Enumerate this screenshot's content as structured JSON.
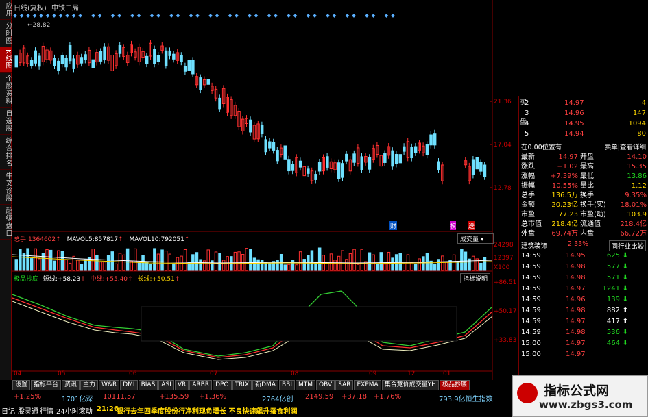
{
  "header": {
    "title": "日线(复权)",
    "stock_name": "中铁二局",
    "high_label": "28.82"
  },
  "sidebar": {
    "tabs": [
      {
        "label": "应用"
      },
      {
        "label": "分时图"
      },
      {
        "label": "K线图",
        "active": true
      },
      {
        "label": "个股资料"
      },
      {
        "label": "自选股"
      },
      {
        "label": "综合排名"
      },
      {
        "label": "牛叉诊股"
      },
      {
        "label": "超级盘口"
      }
    ]
  },
  "price_axis": {
    "labels": [
      "21.36",
      "17.04",
      "12.78"
    ]
  },
  "volume_panel": {
    "vol_label": "总手:",
    "vol_value": "1364602",
    "mavol5_label": "MAVOL5:",
    "mavol5_value": "857817",
    "mavol10_label": "MAVOL10:",
    "mavol10_value": "792051",
    "axis": [
      "24298",
      "12397",
      "X100"
    ],
    "dropdown": "成交量"
  },
  "indicator_panel": {
    "name": "极品抄底",
    "short_label": "短线:",
    "short_value": "+58.23",
    "mid_label": "中线:",
    "mid_value": "+55.40",
    "long_label": "长线:",
    "long_value": "+50.51",
    "axis": [
      "+86.51",
      "+50.17",
      "+33.83"
    ],
    "help": "指标说明"
  },
  "event_marks": {
    "cai1": "财",
    "cai2": "财",
    "quan": "权",
    "zeng": "送"
  },
  "date_axis": [
    "04",
    "05",
    "06",
    "07",
    "08",
    "09",
    "12",
    "01"
  ],
  "quote": {
    "asks": [
      {
        "level": "2",
        "price": "14.97",
        "vol": "4"
      },
      {
        "level": "3",
        "price": "14.96",
        "vol": "147"
      },
      {
        "level": "4",
        "price": "14.95",
        "vol": "1094"
      },
      {
        "level": "5",
        "price": "14.94",
        "vol": "80"
      }
    ],
    "ask_label": "买",
    "ask_label2": "盘",
    "position_text": "在0.00位置有",
    "link1": "卖单",
    "link2": "查看详细",
    "fields": [
      {
        "l1": "最新",
        "v1": "14.97",
        "l2": "开盘",
        "v2": "14.10"
      },
      {
        "l1": "涨跌",
        "v1": "+1.02",
        "l2": "最高",
        "v2": "15.35"
      },
      {
        "l1": "涨幅",
        "v1": "+7.39%",
        "l2": "最低",
        "v2": "13.86"
      },
      {
        "l1": "振幅",
        "v1": "10.55%",
        "l2": "量比",
        "v2": "1.12"
      },
      {
        "l1": "总手",
        "v1": "136.5万",
        "l2": "换手",
        "v2": "9.35%"
      },
      {
        "l1": "金额",
        "v1": "20.23亿",
        "l2": "换手(实)",
        "v2": "18.01%"
      },
      {
        "l1": "市盈",
        "v1": "77.23",
        "l2": "市盈(动)",
        "v2": "103.9"
      },
      {
        "l1": "总市值",
        "v1": "218.4亿",
        "l2": "流通值",
        "v2": "218.4亿"
      },
      {
        "l1": "外盘",
        "v1": "69.74万",
        "l2": "内盘",
        "v2": "66.72万"
      }
    ],
    "sector": "建筑装饰",
    "sector_pct": "2.33%",
    "sector_link": "同行业比较",
    "ticks": [
      {
        "t": "14:59",
        "p": "14.95",
        "v": "625",
        "d": "down"
      },
      {
        "t": "14:59",
        "p": "14.98",
        "v": "577",
        "d": "down"
      },
      {
        "t": "14:59",
        "p": "14.98",
        "v": "571",
        "d": "down"
      },
      {
        "t": "14:59",
        "p": "14.97",
        "v": "1241",
        "d": "down"
      },
      {
        "t": "14:59",
        "p": "14.96",
        "v": "139",
        "d": "down"
      },
      {
        "t": "14:59",
        "p": "14.98",
        "v": "882",
        "d": "up"
      },
      {
        "t": "14:59",
        "p": "14.97",
        "v": "417",
        "d": "up"
      },
      {
        "t": "14:59",
        "p": "14.98",
        "v": "536",
        "d": "down"
      },
      {
        "t": "15:00",
        "p": "14.97",
        "v": "464",
        "d": "down"
      },
      {
        "t": "15:00",
        "p": "14.97",
        "v": "",
        "d": ""
      }
    ]
  },
  "bottom_tabs": [
    "设置",
    "指标平台",
    "资讯",
    "主力",
    "W&R",
    "DMI",
    "BIAS",
    "ASI",
    "VR",
    "ARBR",
    "DPO",
    "TRIX",
    "新DMA",
    "BBI",
    "MTM",
    "OBV",
    "SAR",
    "EXPMA",
    "集合竞价成交量YH",
    "极品抄底"
  ],
  "tickers": {
    "r1": [
      {
        "t": "+1.25%",
        "c": "red"
      },
      {
        "t": "1701亿深",
        "c": "cyan"
      },
      {
        "t": "10111.57",
        "c": "red"
      },
      {
        "t": "+135.59",
        "c": "red"
      },
      {
        "t": "+1.36%",
        "c": "red"
      },
      {
        "t": "2764亿创",
        "c": "cyan"
      },
      {
        "t": "2149.59",
        "c": "red"
      },
      {
        "t": "+37.18",
        "c": "red"
      },
      {
        "t": "+1.76%",
        "c": "red"
      },
      {
        "t": "793.9亿恒生指数",
        "c": "cyan"
      }
    ],
    "r2": [
      {
        "t": "日记",
        "c": "white"
      },
      {
        "t": "股灵通",
        "c": "white"
      },
      {
        "t": "行情",
        "c": "white"
      },
      {
        "t": "24小时滚动",
        "c": "white"
      },
      {
        "t": "21:26",
        "c": "yellow"
      },
      {
        "t": "银行去年四季度股份行净利现负增长 不良快速飙升蚕食利润",
        "c": "yellow"
      }
    ]
  },
  "watermark": {
    "title": "指标公式网",
    "url": "www.zbgs3.com"
  }
}
